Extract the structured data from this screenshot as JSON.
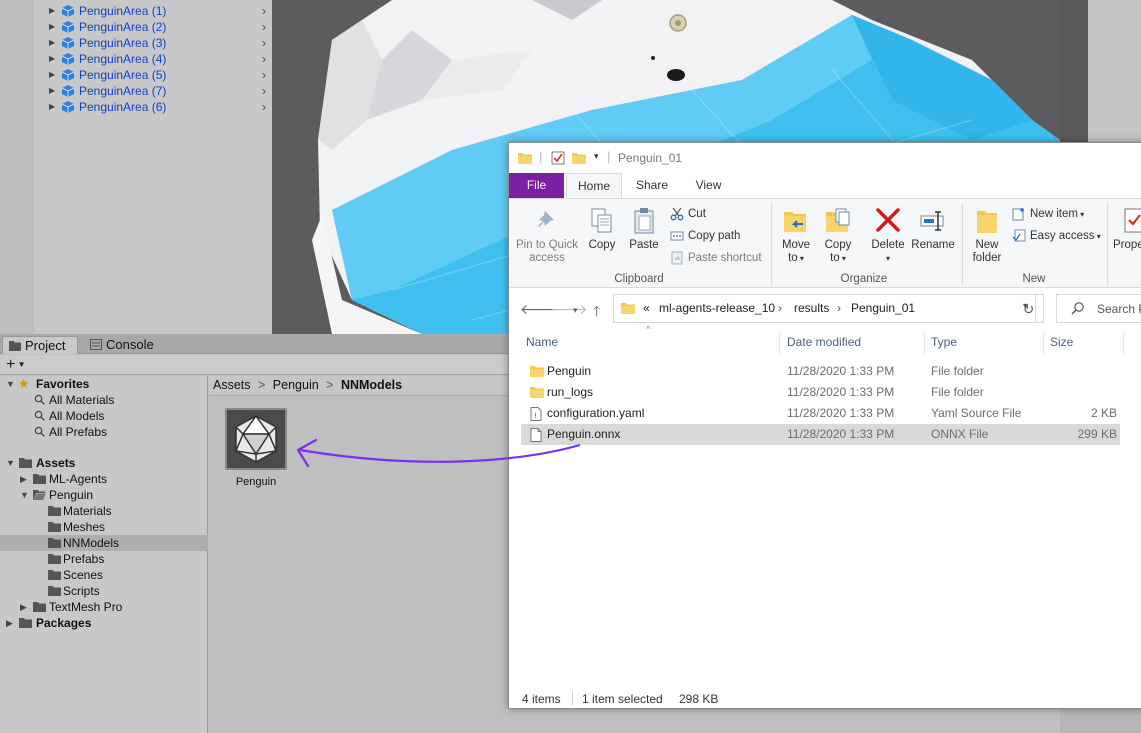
{
  "hierarchy": {
    "items": [
      {
        "label": "PenguinArea (1)"
      },
      {
        "label": "PenguinArea (2)"
      },
      {
        "label": "PenguinArea (3)"
      },
      {
        "label": "PenguinArea (4)"
      },
      {
        "label": "PenguinArea (5)"
      },
      {
        "label": "PenguinArea (7)"
      },
      {
        "label": "PenguinArea (6)"
      }
    ],
    "text_color": "#1142c6"
  },
  "project_panel": {
    "tabs": [
      {
        "label": "Project"
      },
      {
        "label": "Console"
      }
    ],
    "add_label": "+",
    "favorites": {
      "label": "Favorites",
      "items": [
        {
          "label": "All Materials"
        },
        {
          "label": "All Models"
        },
        {
          "label": "All Prefabs"
        }
      ]
    },
    "assets": {
      "label": "Assets",
      "items": [
        {
          "label": "ML-Agents"
        },
        {
          "label": "Penguin"
        },
        {
          "label": "Materials"
        },
        {
          "label": "Meshes"
        },
        {
          "label": "NNModels"
        },
        {
          "label": "Prefabs"
        },
        {
          "label": "Scenes"
        },
        {
          "label": "Scripts"
        },
        {
          "label": "TextMesh Pro"
        }
      ]
    },
    "packages_label": "Packages",
    "breadcrumb": [
      "Assets",
      ">",
      "Penguin",
      ">",
      "NNModels"
    ],
    "asset_name": "Penguin"
  },
  "explorer": {
    "title": "Penguin_01",
    "ribbon_tabs": [
      {
        "label": "File"
      },
      {
        "label": "Home"
      },
      {
        "label": "Share"
      },
      {
        "label": "View"
      }
    ],
    "ribbon": {
      "pin_label_1": "Pin to Quick",
      "pin_label_2": "access",
      "copy_label": "Copy",
      "paste_label": "Paste",
      "cut_label": "Cut",
      "copy_path_label": "Copy path",
      "paste_shortcut_label": "Paste shortcut",
      "clipboard_group": "Clipboard",
      "move_to_label_1": "Move",
      "move_to_label_2": "to",
      "copy_to_label_1": "Copy",
      "copy_to_label_2": "to",
      "delete_label": "Delete",
      "rename_label": "Rename",
      "organize_group": "Organize",
      "new_folder_label_1": "New",
      "new_folder_label_2": "folder",
      "new_item_label": "New item",
      "easy_access_label": "Easy access",
      "new_group": "New",
      "properties_label": "Prope"
    },
    "address": {
      "overflow": "«",
      "crumbs": [
        "ml-agents-release_10",
        "results",
        "Penguin_01"
      ]
    },
    "search_placeholder": "Search P",
    "columns": [
      "Name",
      "Date modified",
      "Type",
      "Size"
    ],
    "files": [
      {
        "name": "Penguin",
        "date": "11/28/2020 1:33 PM",
        "type": "File folder",
        "size": ""
      },
      {
        "name": "run_logs",
        "date": "11/28/2020 1:33 PM",
        "type": "File folder",
        "size": ""
      },
      {
        "name": "configuration.yaml",
        "date": "11/28/2020 1:33 PM",
        "type": "Yaml Source File",
        "size": "2 KB"
      },
      {
        "name": "Penguin.onnx",
        "date": "11/28/2020 1:33 PM",
        "type": "ONNX File",
        "size": "299 KB"
      }
    ],
    "status": {
      "count": "4 items",
      "selection": "1 item selected",
      "selection_size": "298 KB"
    },
    "accent_color": "#7a1fa2"
  },
  "drag_arrow_color": "#7b2ff0"
}
